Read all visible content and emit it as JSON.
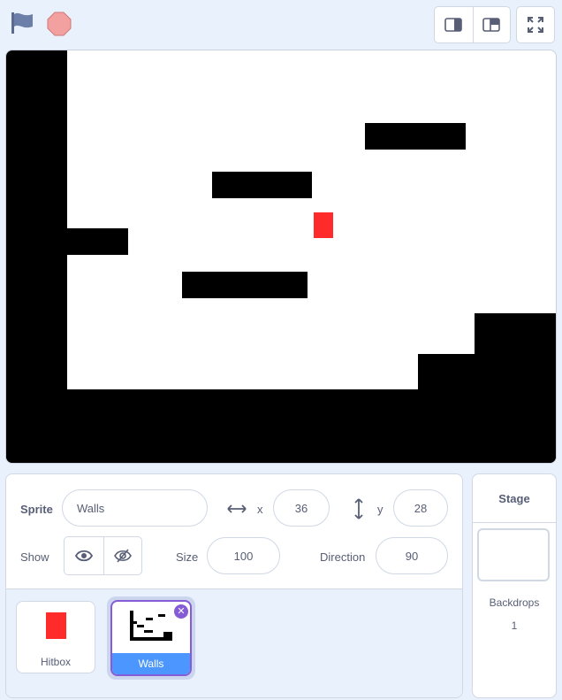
{
  "toolbar": {
    "green_flag_icon": "flag-icon",
    "stop_icon": "stop-icon",
    "small_stage_icon": "small-stage-icon",
    "normal_stage_icon": "normal-stage-icon",
    "fullscreen_icon": "fullscreen-icon"
  },
  "colors": {
    "wall": "#000000",
    "hitbox": "#ff2a2a",
    "accent": "#855cd6",
    "selected_label_bg": "#4c97ff"
  },
  "sprite_info": {
    "sprite_label": "Sprite",
    "sprite_name": "Walls",
    "x_label": "x",
    "x_value": "36",
    "y_label": "y",
    "y_value": "28",
    "show_label": "Show",
    "size_label": "Size",
    "size_value": "100",
    "direction_label": "Direction",
    "direction_value": "90"
  },
  "sprites": [
    {
      "name": "Hitbox",
      "selected": false
    },
    {
      "name": "Walls",
      "selected": true
    }
  ],
  "stage_pane": {
    "title": "Stage",
    "backdrops_label": "Backdrops",
    "backdrops_count": "1"
  }
}
